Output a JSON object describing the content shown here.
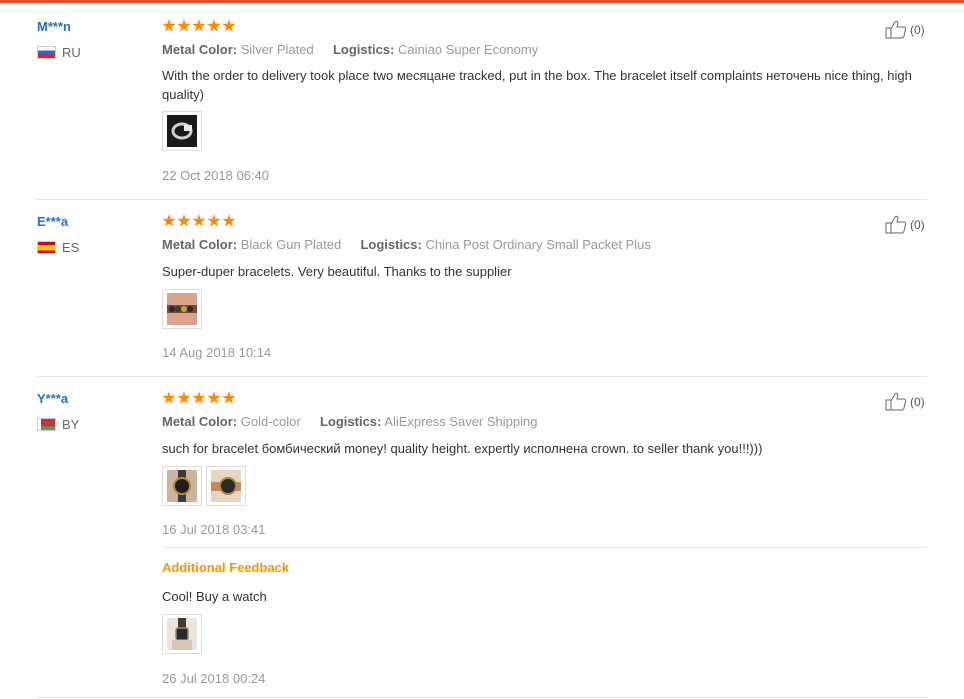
{
  "reviews": [
    {
      "user": "M***n",
      "country": "RU",
      "flag": "flag-ru",
      "rating": 5,
      "metal_label": "Metal Color:",
      "metal_value": "Silver Plated",
      "logistics_label": "Logistics:",
      "logistics_value": "Cainiao Super Economy",
      "text": "With the order to delivery took place two месяцане tracked, put in the box. The bracelet itself complaints неточень nice thing, high quality)",
      "photos": [
        "bracelet-photo"
      ],
      "date": "22 Oct 2018 06:40",
      "likes": "(0)"
    },
    {
      "user": "E***a",
      "country": "ES",
      "flag": "flag-es",
      "rating": 5,
      "metal_label": "Metal Color:",
      "metal_value": "Black Gun Plated",
      "logistics_label": "Logistics:",
      "logistics_value": "China Post Ordinary Small Packet Plus",
      "text": "Super-duper bracelets. Very beautiful. Thanks to the supplier",
      "photos": [
        "bracelet-photo"
      ],
      "date": "14 Aug 2018 10:14",
      "likes": "(0)"
    },
    {
      "user": "Y***a",
      "country": "BY",
      "flag": "flag-by",
      "rating": 5,
      "metal_label": "Metal Color:",
      "metal_value": "Gold-color",
      "logistics_label": "Logistics:",
      "logistics_value": "AliExpress Saver Shipping",
      "text": "such for bracelet бомбический money! quality height. expertly исполнена crown. to seller thank you!!!)))",
      "photos": [
        "watch-photo",
        "watch-photo"
      ],
      "date": "16 Jul 2018 03:41",
      "likes": "(0)",
      "additional": {
        "label": "Additional Feedback",
        "text": "Cool! Buy a watch",
        "photos": [
          "watch-photo"
        ],
        "date": "26 Jul 2018 00:24"
      }
    }
  ]
}
